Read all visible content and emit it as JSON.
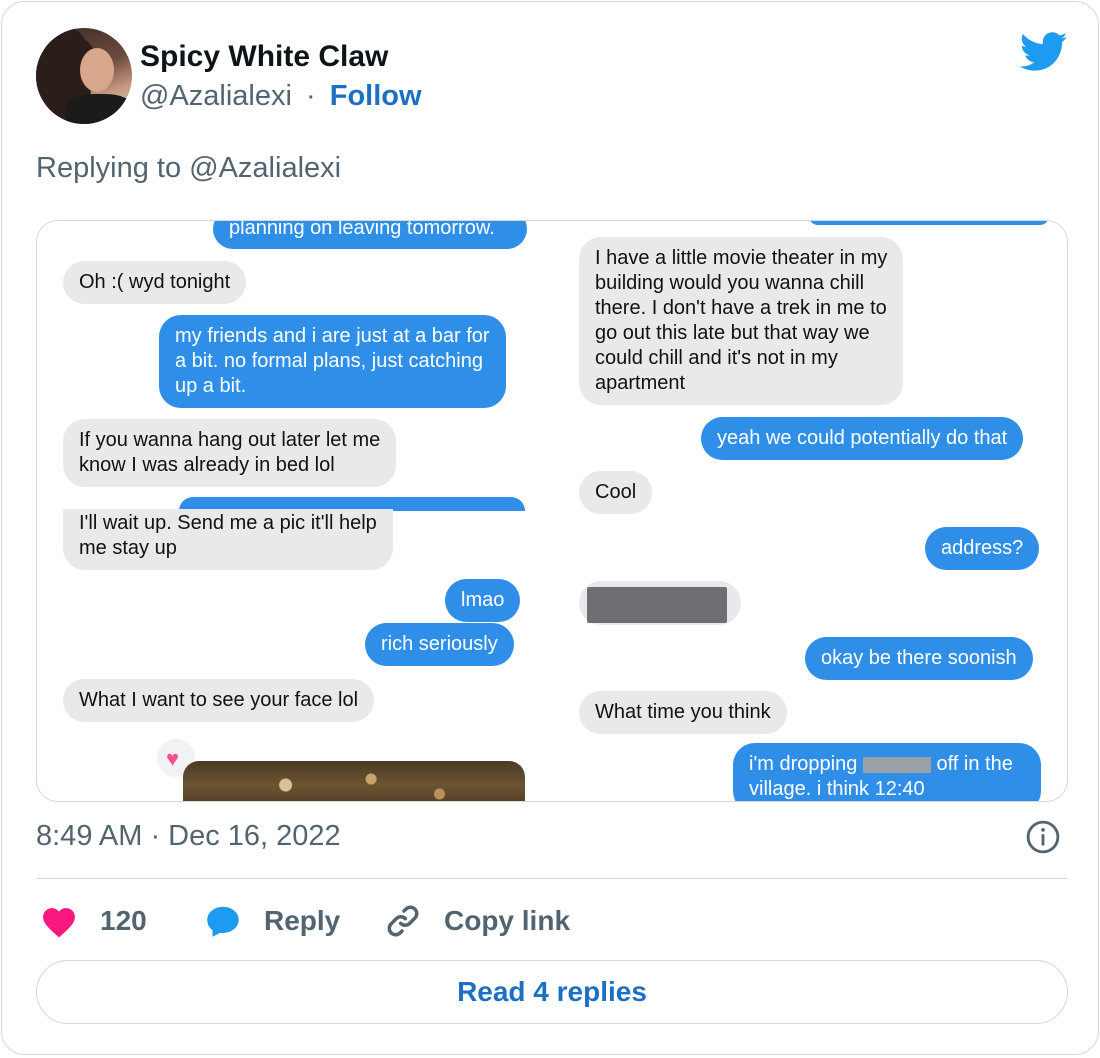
{
  "tweet": {
    "author_name": "Spicy White Claw",
    "author_handle": "@Azalialexi",
    "separator": "·",
    "follow_label": "Follow",
    "replying_to": "Replying to @Azalialexi",
    "timestamp": "8:49 AM · Dec 16, 2022"
  },
  "media": {
    "left_column": [
      {
        "side": "out",
        "text": "planning on leaving tomorrow."
      },
      {
        "side": "in",
        "text": "Oh :( wyd tonight"
      },
      {
        "side": "out",
        "text": "my friends and i are just at a bar for\na bit. no formal plans, just catching\nup a bit."
      },
      {
        "side": "in",
        "text": "If you wanna hang out later let me\nknow I was already in bed lol"
      },
      {
        "side": "in",
        "text": "I'll wait up. Send me a pic it'll help\nme stay up"
      },
      {
        "side": "out",
        "text": "lmao"
      },
      {
        "side": "out",
        "text": "rich seriously"
      },
      {
        "side": "in",
        "text": "What I want to see your face lol"
      }
    ],
    "right_column": [
      {
        "side": "in",
        "text": "I have a little movie theater in my\nbuilding would you wanna chill\nthere. I don't have a trek in me to\ngo out this late but that way we\ncould chill and it's not in my\napartment"
      },
      {
        "side": "out",
        "text": "yeah we could potentially do that"
      },
      {
        "side": "in",
        "text": "Cool"
      },
      {
        "side": "out",
        "text": "address?"
      },
      {
        "side": "out",
        "text": "okay be there soonish"
      },
      {
        "side": "in",
        "text": "What time you think"
      },
      {
        "side": "out",
        "text_a": "i'm dropping",
        "text_b": "off in the",
        "text_c": "village. i think 12:40"
      }
    ]
  },
  "actions": {
    "like_count": "120",
    "reply_label": "Reply",
    "copy_label": "Copy link",
    "read_replies_label": "Read 4 replies"
  },
  "colors": {
    "accent": "#1d9bf0",
    "like": "#f91880",
    "bubble_out": "#2f8fe8",
    "bubble_in": "#e9e9eb"
  },
  "icons": {
    "brand": "twitter-bird-icon",
    "info": "info-icon",
    "like": "heart-icon",
    "reply": "speech-bubble-icon",
    "copy": "link-icon"
  }
}
